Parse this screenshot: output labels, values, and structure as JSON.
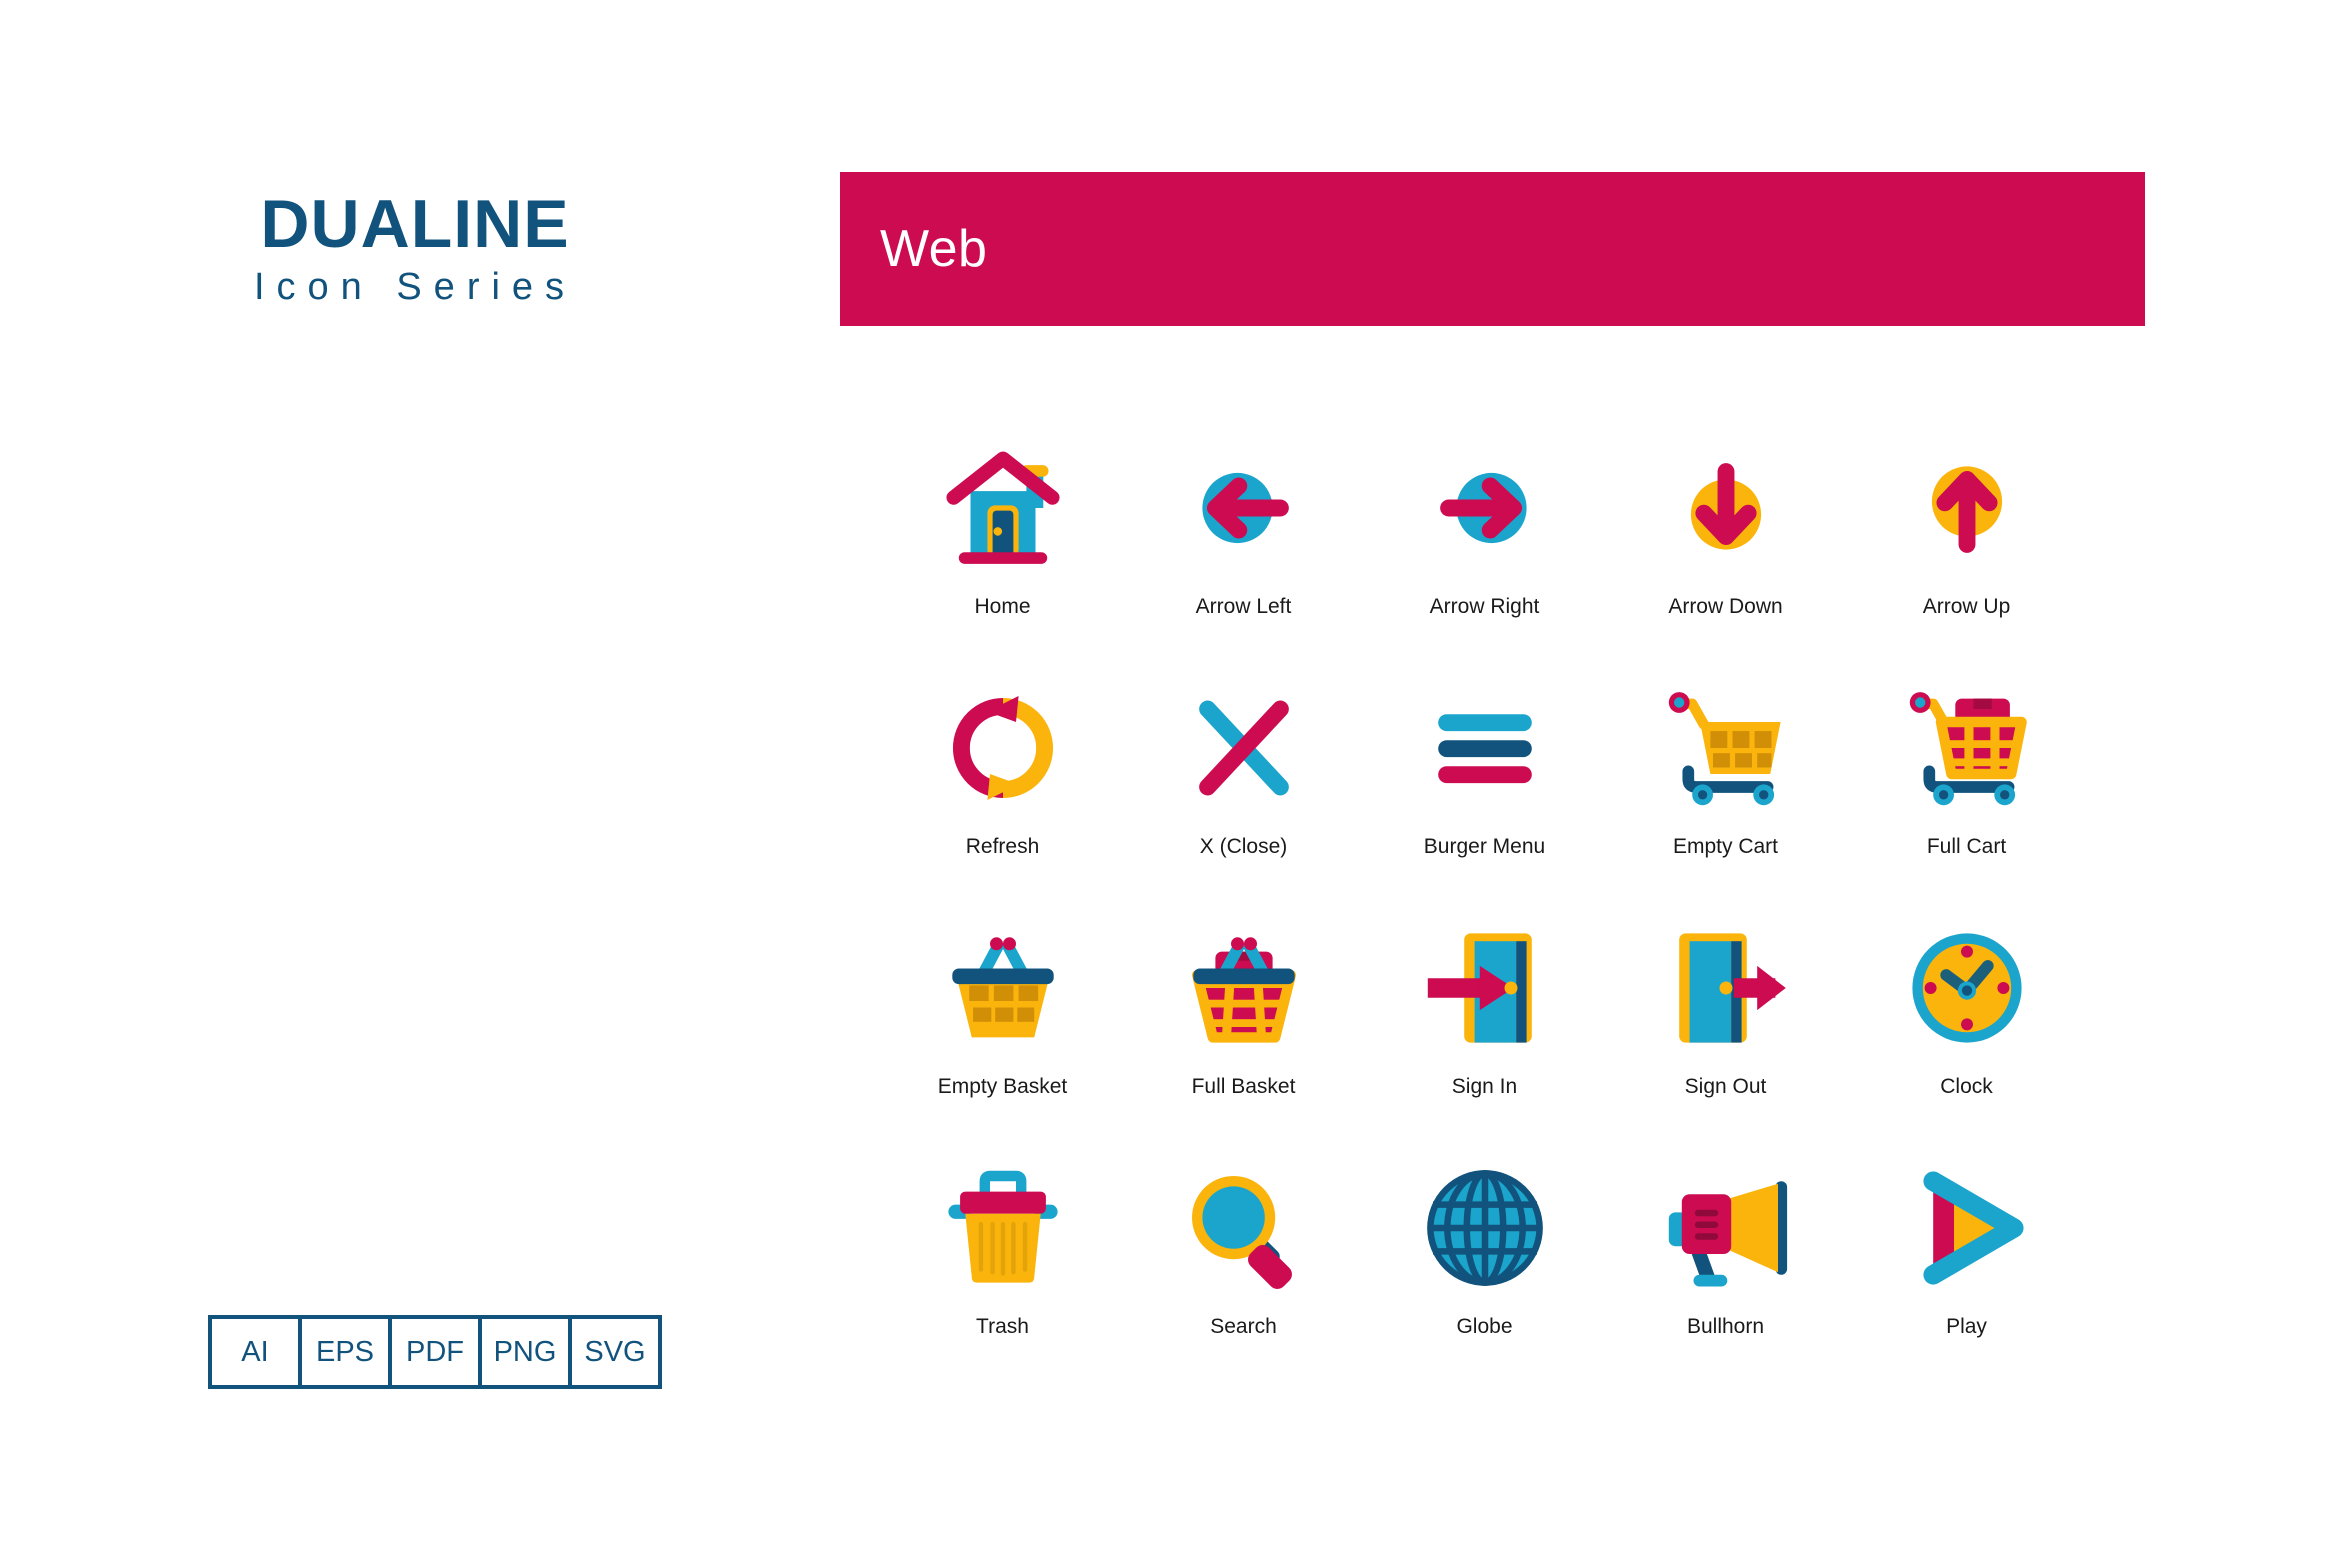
{
  "brand": {
    "title": "DUALINE",
    "subtitle": "Icon Series"
  },
  "formats": {
    "items": [
      {
        "label": "AI"
      },
      {
        "label": "EPS"
      },
      {
        "label": "PDF"
      },
      {
        "label": "PNG"
      },
      {
        "label": "SVG"
      }
    ]
  },
  "category": {
    "title": "Web",
    "banner_color": "#cc0b51"
  },
  "palette": {
    "crimson": "#cc0b51",
    "cyan": "#1ba5cc",
    "navy": "#11537d",
    "amber": "#fbb40c",
    "amber_dark": "#d18f07",
    "crimson_dark": "#a30a41",
    "text": "#1a1a1a",
    "white": "#ffffff"
  },
  "icons": [
    {
      "name": "home-icon",
      "label": "Home"
    },
    {
      "name": "arrow-left-icon",
      "label": "Arrow Left"
    },
    {
      "name": "arrow-right-icon",
      "label": "Arrow Right"
    },
    {
      "name": "arrow-down-icon",
      "label": "Arrow Down"
    },
    {
      "name": "arrow-up-icon",
      "label": "Arrow Up"
    },
    {
      "name": "refresh-icon",
      "label": "Refresh"
    },
    {
      "name": "close-icon",
      "label": "X (Close)"
    },
    {
      "name": "burger-menu-icon",
      "label": "Burger Menu"
    },
    {
      "name": "empty-cart-icon",
      "label": "Empty Cart"
    },
    {
      "name": "full-cart-icon",
      "label": "Full Cart"
    },
    {
      "name": "empty-basket-icon",
      "label": "Empty Basket"
    },
    {
      "name": "full-basket-icon",
      "label": "Full Basket"
    },
    {
      "name": "sign-in-icon",
      "label": "Sign In"
    },
    {
      "name": "sign-out-icon",
      "label": "Sign Out"
    },
    {
      "name": "clock-icon",
      "label": "Clock"
    },
    {
      "name": "trash-icon",
      "label": "Trash"
    },
    {
      "name": "search-icon",
      "label": "Search"
    },
    {
      "name": "globe-icon",
      "label": "Globe"
    },
    {
      "name": "bullhorn-icon",
      "label": "Bullhorn"
    },
    {
      "name": "play-icon",
      "label": "Play"
    }
  ]
}
